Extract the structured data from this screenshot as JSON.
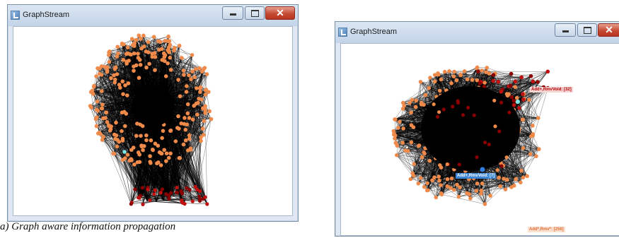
{
  "windows": [
    {
      "title": "GraphStream",
      "controls": {
        "minimize": "minimize",
        "maximize": "maximize",
        "close": "close"
      }
    },
    {
      "title": "GraphStream",
      "controls": {
        "minimize": "minimize",
        "maximize": "maximize",
        "close": "close"
      },
      "labels": {
        "add_rmv_void": "Add+,RmvVoid: [32]",
        "add_rmvvoid_blue": "Add+,RmvVoid: [7]",
        "add_rmv": "Add*,Rmv*: [256]"
      }
    }
  ],
  "caption": "a)  Graph aware information propagation",
  "colors": {
    "node_orange": "#f08a4a",
    "node_darkred": "#8a0000",
    "node_red": "#c01010",
    "node_cyan": "#7fe6e6",
    "node_blue": "#2f7fe0",
    "edge": "#000000",
    "close_button": "#c54a34"
  }
}
